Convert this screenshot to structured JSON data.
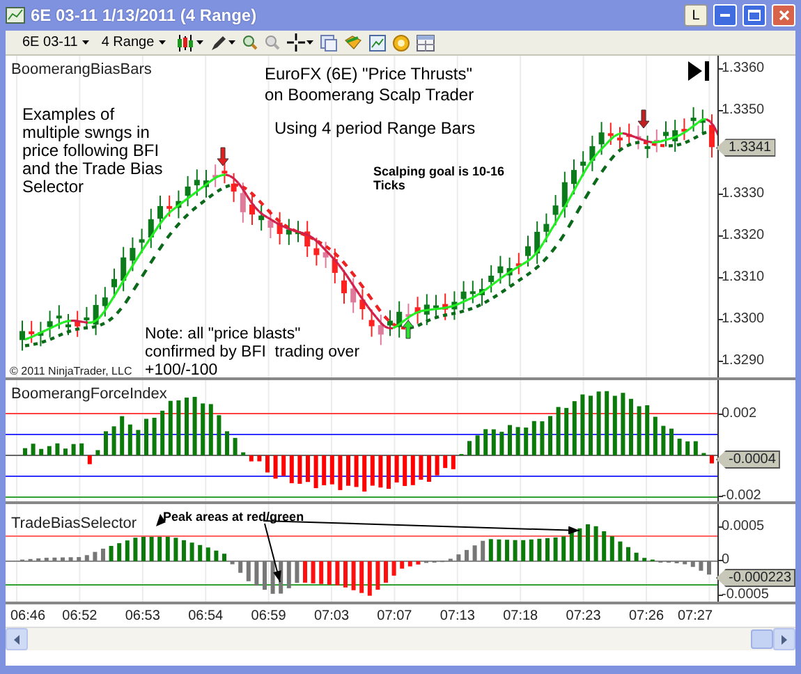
{
  "window": {
    "title": "6E 03-11  1/13/2011 (4 Range)",
    "buttons": [
      "L"
    ]
  },
  "toolbar": {
    "instrument": "6E 03-11",
    "period": "4 Range"
  },
  "price_panel": {
    "title": "BoomerangBiasBars",
    "heading": [
      "EuroFX (6E) \"Price Thrusts\"",
      "on Boomerang Scalp Trader"
    ],
    "subheading": "Using 4 period Range Bars",
    "examples_note": "Examples of multiple swngs in price following BFI and the Trade Bias Selector",
    "goal_note": "Scalping goal is 10-16 Ticks",
    "blast_note": "Note: all \"price blasts\" confirmed by BFI  trading over +100/-100",
    "copyright": "© 2011 NinjaTrader, LLC",
    "y_labels": [
      "1.3360",
      "1.3350",
      "1.3330",
      "1.3320",
      "1.3310",
      "1.3300",
      "1.3290"
    ],
    "last_value": "1.3341"
  },
  "force_panel": {
    "title": "BoomerangForceIndex",
    "y_labels": [
      "0.002",
      "-0.002"
    ],
    "last_value": "-0.0004"
  },
  "bias_panel": {
    "title": "TradeBiasSelector",
    "note": "Peak areas at red/green",
    "y_labels": [
      "0.0005",
      "0",
      "-0.0005"
    ],
    "last_value": "-0.000223"
  },
  "time_axis": [
    "06:46",
    "06:52",
    "06:53",
    "06:54",
    "06:59",
    "07:03",
    "07:07",
    "07:13",
    "07:18",
    "07:23",
    "07:26",
    "07:27"
  ]
}
